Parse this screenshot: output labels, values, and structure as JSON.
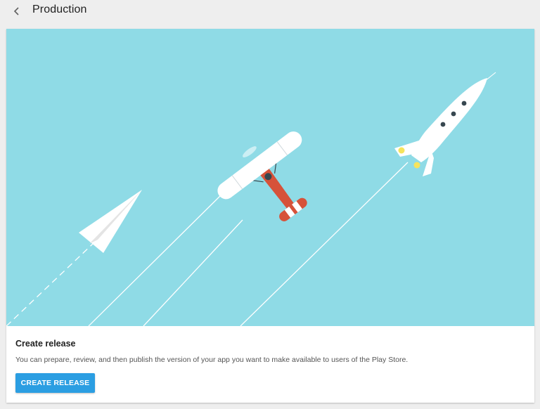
{
  "header": {
    "title": "Production",
    "back_icon": "chevron-left-icon"
  },
  "hero": {
    "background_color": "#8fdbe6",
    "illustrations": [
      "paper-plane-icon",
      "biplane-icon",
      "rocket-icon"
    ]
  },
  "release_card": {
    "title": "Create release",
    "description": "You can prepare, review, and then publish the version of your app you want to make available to users of the Play Store.",
    "button_label": "CREATE RELEASE",
    "button_color": "#2b9ee2"
  }
}
